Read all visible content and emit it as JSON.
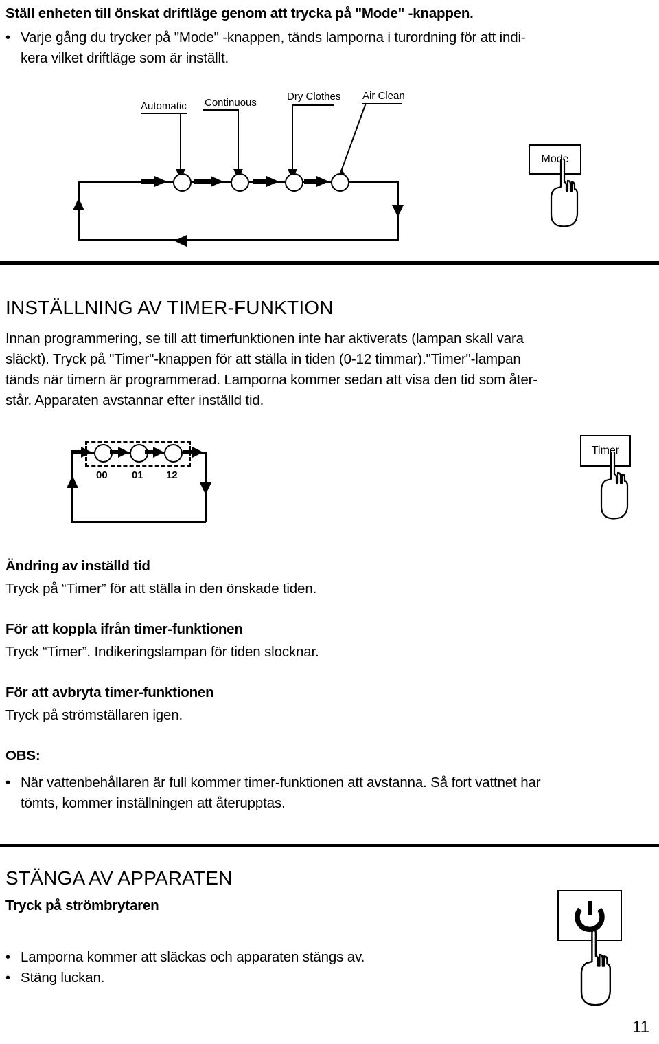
{
  "page": {
    "number": "11"
  },
  "intro": {
    "heading": "Ställ enheten till önskat driftläge genom att trycka på \"Mode\" -knappen.",
    "bullet_line1": "Varje gång du trycker på \"Mode\" -knappen, tänds lamporna i turordning för att indi-",
    "bullet_line2": "kera vilket driftläge som är inställt.",
    "bullet_glyph": "•"
  },
  "mode_diagram": {
    "labels": [
      "Automatic",
      "Continuous",
      "Dry Clothes",
      "Air Clean"
    ],
    "button_label": "Mode",
    "icon": "pointing-hand-icon"
  },
  "timer_section": {
    "heading": "INSTÄLLNING AV TIMER-FUNKTION",
    "body_line1": "Innan programmering, se till att timerfunktionen inte har aktiverats (lampan skall vara",
    "body_line2": "släckt). Tryck på \"Timer\"-knappen för att ställa in tiden (0-12 timmar).\"Timer\"-lampan",
    "body_line3": "tänds när timern är programmerad. Lamporna kommer sedan att visa den tid som åter-",
    "body_line4": "står. Apparaten avstannar efter inställd tid."
  },
  "timer_diagram": {
    "values": [
      "00",
      "01",
      "12"
    ],
    "button_label": "Timer",
    "icon": "pointing-hand-icon"
  },
  "timer_instructions": [
    {
      "title": "Ändring av inställd tid",
      "body": "Tryck på “Timer” för att ställa in den önskade tiden."
    },
    {
      "title": "För att koppla ifrån timer-funktionen",
      "body": "Tryck “Timer”. Indikeringslampan för tiden slocknar."
    },
    {
      "title": "För att avbryta timer-funktionen",
      "body": "Tryck på strömställaren igen."
    }
  ],
  "note": {
    "title": "OBS:",
    "bullet_glyph": "•",
    "line1": "När vattenbehållaren är full kommer timer-funktionen att avstanna. Så fort vattnet har",
    "line2": "tömts, kommer inställningen att återupptas."
  },
  "shutdown": {
    "heading": "STÄNGA AV APPARATEN",
    "subheading": "Tryck på strömbrytaren",
    "bullet_glyph": "•",
    "bullet1": "Lamporna kommer att släckas och apparaten stängs av.",
    "bullet2": "Stäng luckan.",
    "icon_button": "power-symbol-icon",
    "icon_hand": "pointing-hand-icon"
  }
}
